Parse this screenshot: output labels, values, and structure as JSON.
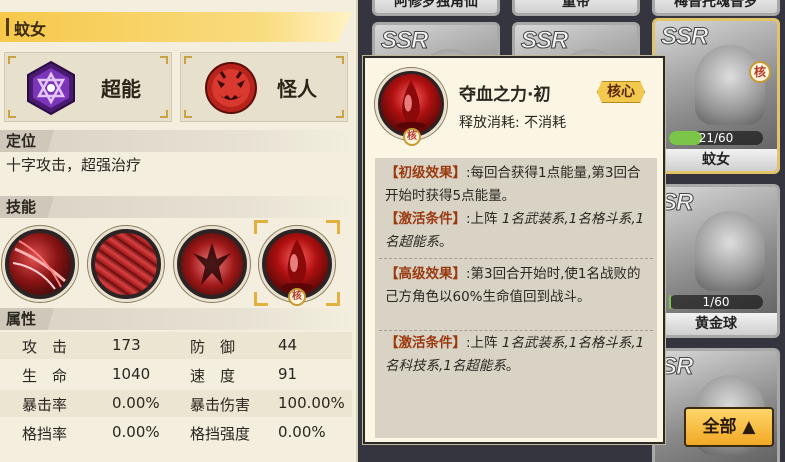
{
  "hero": {
    "name": "蚊女",
    "type_ability": "超能",
    "type_class": "怪人"
  },
  "sections": {
    "role_title": "定位",
    "role_text": "十字攻击，超强治疗",
    "skills_title": "技能",
    "attr_title": "属性"
  },
  "skills": [
    {
      "name": "skill-1"
    },
    {
      "name": "skill-2"
    },
    {
      "name": "skill-3"
    },
    {
      "name": "skill-4",
      "selected": true,
      "badge": "核"
    }
  ],
  "attributes": [
    {
      "k1": "攻　击",
      "v1": "173",
      "k2": "防　御",
      "v2": "44"
    },
    {
      "k1": "生　命",
      "v1": "1040",
      "k2": "速　度",
      "v2": "91"
    },
    {
      "k1": "暴击率",
      "v1": "0.00%",
      "k2": "暴击伤害",
      "v2": "100.00%"
    },
    {
      "k1": "格挡率",
      "v1": "0.00%",
      "k2": "格挡强度",
      "v2": "0.00%"
    }
  ],
  "tooltip": {
    "title": "夺血之力·初",
    "tag": "核心",
    "icon_badge": "核",
    "cost": "释放消耗: 不消耗",
    "basic_label": "【初级效果】",
    "basic_text": ":每回合获得1点能量,第3回合开始时获得5点能量。",
    "cond_label": "【激活条件】",
    "cond1_a": ":上阵 ",
    "cond1_b": "1名武装系,1名格斗系,1名超能系",
    "cond1_c": "。",
    "adv_label": "【高级效果】",
    "adv_text": ":第3回合开始时,使1名战败的己方角色以60%生命值回到战斗。",
    "cond2_a": ":上阵 ",
    "cond2_b": "1名武装系,1名格斗系,1名科技系,1名超能系",
    "cond2_c": "。"
  },
  "cards": [
    {
      "top": "阿修罗独角仙",
      "rarity": "",
      "name": ""
    },
    {
      "top": "童帝",
      "rarity": "",
      "name": ""
    },
    {
      "top": "梅普托魂普罗",
      "rarity": "",
      "name": ""
    },
    {
      "top": "",
      "rarity": "SSR",
      "name": ""
    },
    {
      "top": "",
      "rarity": "SSR",
      "name": ""
    },
    {
      "top": "",
      "rarity": "SSR",
      "name": "蚊女",
      "progress": "21/60",
      "progress_value": 0.35,
      "badge": "核"
    },
    {
      "top": "",
      "rarity": "SR",
      "name": "黄金球",
      "progress": "1/60",
      "progress_value": 0.0167
    },
    {
      "top": "",
      "rarity": "SR",
      "name": ""
    }
  ],
  "filter_button": "全部 ▲",
  "colors": {
    "panel_bg": "#f3eedd",
    "name_bar": "#f6c84a",
    "accent_gold": "#e2b13d",
    "tooltip_highlight": "#9a3a10",
    "progress_green": "#7bc548"
  }
}
